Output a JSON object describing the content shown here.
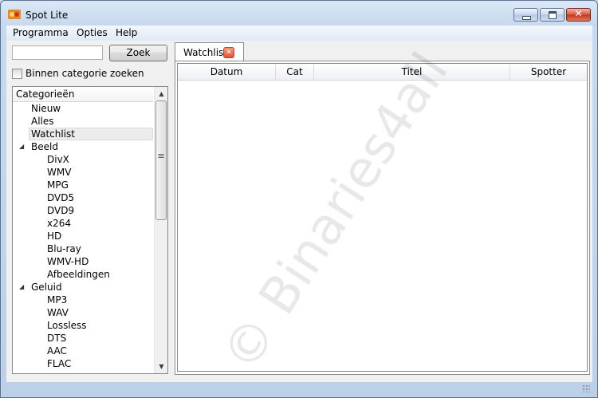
{
  "window": {
    "title": "Spot Lite"
  },
  "menu": [
    "Programma",
    "Opties",
    "Help"
  ],
  "search": {
    "value": "",
    "button_label": "Zoek",
    "checkbox_label": "Binnen categorie zoeken",
    "checkbox_checked": false
  },
  "tree": {
    "header": "Categorieën",
    "items": [
      {
        "label": "Nieuw",
        "level": 1
      },
      {
        "label": "Alles",
        "level": 1
      },
      {
        "label": "Watchlist",
        "level": 1,
        "selected": true
      },
      {
        "label": "Beeld",
        "level": 1,
        "expanded": true
      },
      {
        "label": "DivX",
        "level": 2
      },
      {
        "label": "WMV",
        "level": 2
      },
      {
        "label": "MPG",
        "level": 2
      },
      {
        "label": "DVD5",
        "level": 2
      },
      {
        "label": "DVD9",
        "level": 2
      },
      {
        "label": "x264",
        "level": 2
      },
      {
        "label": "HD",
        "level": 2
      },
      {
        "label": "Blu-ray",
        "level": 2
      },
      {
        "label": "WMV-HD",
        "level": 2
      },
      {
        "label": "Afbeeldingen",
        "level": 2
      },
      {
        "label": "Geluid",
        "level": 1,
        "expanded": true
      },
      {
        "label": "MP3",
        "level": 2
      },
      {
        "label": "WAV",
        "level": 2
      },
      {
        "label": "Lossless",
        "level": 2
      },
      {
        "label": "DTS",
        "level": 2
      },
      {
        "label": "AAC",
        "level": 2
      },
      {
        "label": "FLAC",
        "level": 2
      }
    ]
  },
  "tabs": [
    {
      "label": "Watchlist",
      "closable": true
    }
  ],
  "grid": {
    "columns": [
      "Datum",
      "Cat",
      "Titel",
      "Spotter"
    ],
    "rows": []
  },
  "watermark": "© Binaries4all",
  "icons": {
    "tree_expander": "triangle-down-icon",
    "tab_close": "close-icon"
  }
}
